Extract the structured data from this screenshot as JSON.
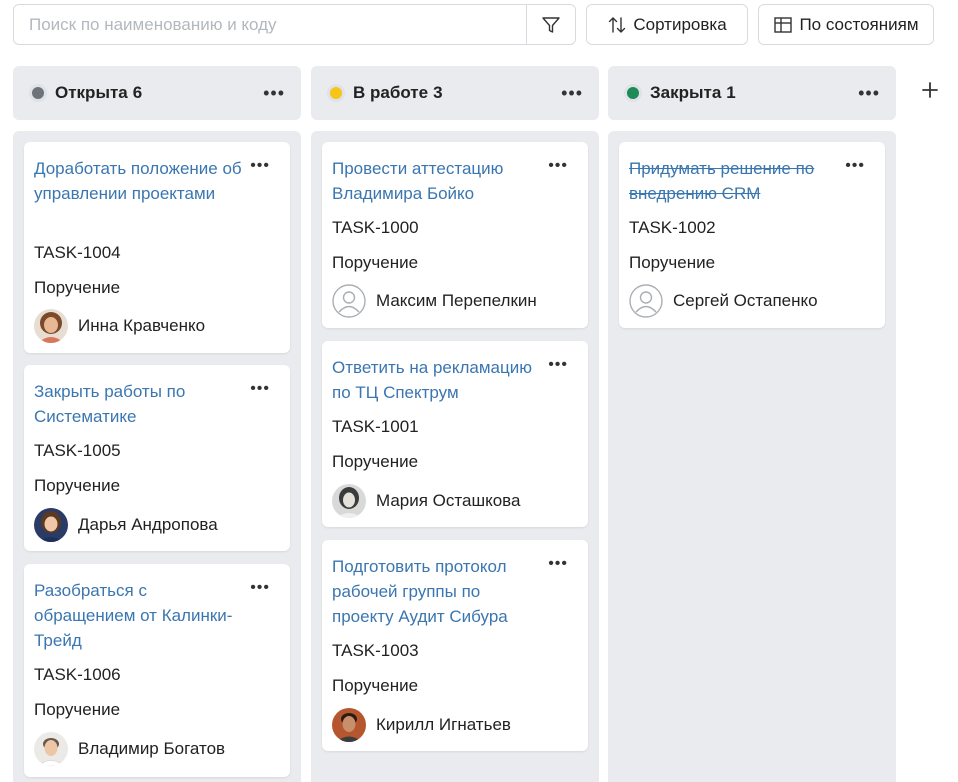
{
  "toolbar": {
    "search_placeholder": "Поиск по наименованию и коду",
    "sort_label": "Сортировка",
    "states_label": "По состояниям"
  },
  "columns": [
    {
      "title": "Открыта",
      "count": "6",
      "color": "#6e7379",
      "cards": [
        {
          "title": "Доработать положение об управлении проектами",
          "code": "TASK-1004",
          "type": "Поручение",
          "user": "Инна Кравченко",
          "done": false
        },
        {
          "title": "Закрыть работы по Систематике",
          "code": "TASK-1005",
          "type": "Поручение",
          "user": "Дарья Андропова",
          "done": false
        },
        {
          "title": "Разобраться с обращением от Калинки-Трейд",
          "code": "TASK-1006",
          "type": "Поручение",
          "user": "Владимир Богатов",
          "done": false
        }
      ]
    },
    {
      "title": "В работе",
      "count": "3",
      "color": "#f5c518",
      "cards": [
        {
          "title": "Провести аттестацию Владимира Бойко",
          "code": "TASK-1000",
          "type": "Поручение",
          "user": "Максим Перепелкин",
          "done": false
        },
        {
          "title": "Ответить на рекламацию по ТЦ Спектрум",
          "code": "TASK-1001",
          "type": "Поручение",
          "user": "Мария Осташкова",
          "done": false
        },
        {
          "title": "Подготовить протокол рабочей группы по проекту Аудит Сибура",
          "code": "TASK-1003",
          "type": "Поручение",
          "user": "Кирилл Игнатьев",
          "done": false
        }
      ]
    },
    {
      "title": "Закрыта",
      "count": "1",
      "color": "#1e8a55",
      "cards": [
        {
          "title": "Придумать решение по внедрению CRM",
          "code": "TASK-1002",
          "type": "Поручение",
          "user": "Сергей Остапенко",
          "done": true
        }
      ]
    }
  ],
  "icons": {
    "filter": "filter-icon",
    "sort": "sort-arrows-icon",
    "states": "table-layout-icon",
    "more": "more-horizontal-icon",
    "add": "plus-icon"
  }
}
